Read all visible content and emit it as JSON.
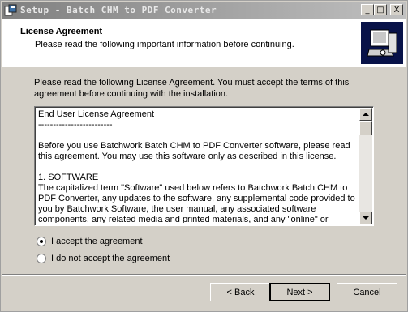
{
  "window": {
    "title": "Setup - Batch CHM to PDF Converter",
    "buttons": {
      "minimize": "_",
      "maximize": "□",
      "close": "X"
    }
  },
  "header": {
    "title": "License Agreement",
    "subtitle": "Please read the following important information before continuing."
  },
  "intro": "Please read the following License Agreement. You must accept the terms of this agreement before continuing with the installation.",
  "license_text": "End User License Agreement\n-------------------------\n\nBefore you use Batchwork Batch CHM to PDF Converter software, please read this agreement. You may use this software only as described in this license.\n\n1. SOFTWARE\nThe capitalized term \"Software\" used below refers to Batchwork Batch CHM to PDF Converter, any updates to the software, any supplemental code provided to you by Batchwork Software, the user manual, any associated software components, any related media and printed materials, and any \"online\" or",
  "options": [
    {
      "label": "I accept the agreement",
      "selected": true
    },
    {
      "label": "I do not accept the agreement",
      "selected": false
    }
  ],
  "footer": {
    "back_label": "< Back",
    "next_label": "Next >",
    "cancel_label": "Cancel"
  }
}
